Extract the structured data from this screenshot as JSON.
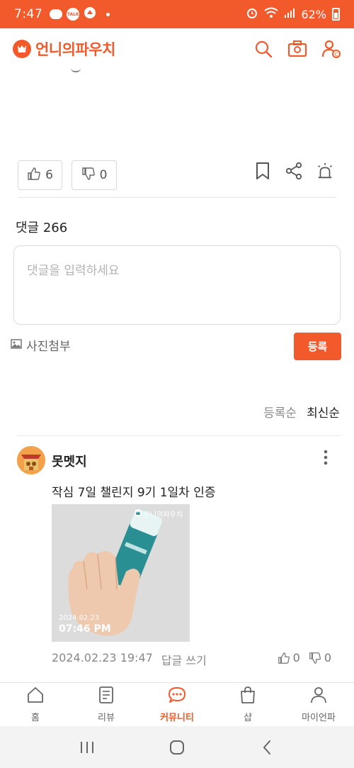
{
  "status_bar": {
    "time": "7:47",
    "talk_badge": "TALK",
    "battery": "62%"
  },
  "app": {
    "logo_text": "언니의파우치"
  },
  "post": {
    "likes": "6",
    "dislikes": "0"
  },
  "comments": {
    "count_label": "댓글 266",
    "input_placeholder": "댓글을 입력하세요",
    "photo_attach_label": "사진첨부",
    "register_label": "등록",
    "sort": {
      "by_registration": "등록순",
      "latest": "최신순"
    },
    "items": [
      {
        "username": "못멧지",
        "text": "작심 7일 챌린지 9기 1일차 인증",
        "photo": {
          "watermark": "언니의파우치",
          "date": "2024.02.23",
          "time": "07:46 PM"
        },
        "date": "2024.02.23 19:47",
        "reply_label": "답글 쓰기",
        "likes": "0",
        "dislikes": "0"
      }
    ]
  },
  "bottom_nav": [
    {
      "label": "홈",
      "icon": "home-icon"
    },
    {
      "label": "리뷰",
      "icon": "review-icon"
    },
    {
      "label": "커뮤니티",
      "icon": "community-icon"
    },
    {
      "label": "샵",
      "icon": "shop-icon"
    },
    {
      "label": "마이언파",
      "icon": "profile-icon"
    }
  ],
  "colors": {
    "brand": "#f35a2b",
    "text": "#222222",
    "muted": "#888888"
  }
}
